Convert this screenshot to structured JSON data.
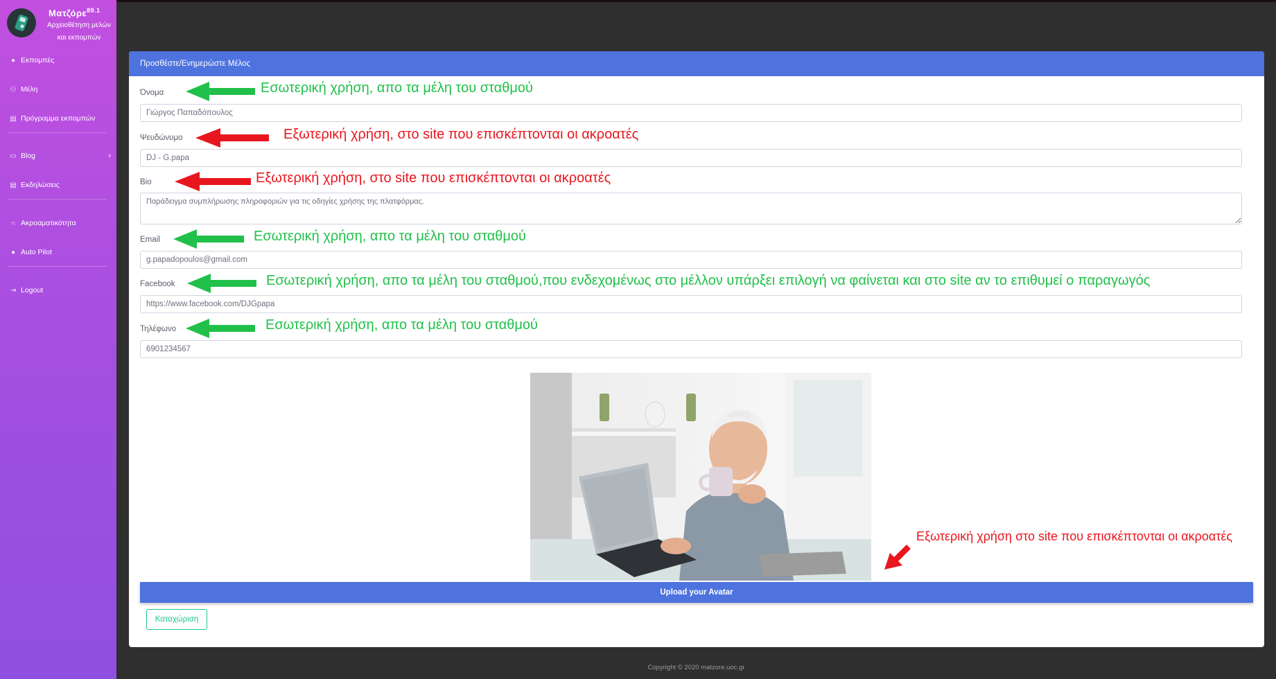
{
  "brand": {
    "title": "Ματζόρε",
    "freq": "89.1",
    "subtitle_line1": "Αρχειοθέτηση μελών",
    "subtitle_line2": "και εκπομπών"
  },
  "sidebar": {
    "items": [
      {
        "label": "Εκπομπές",
        "icon": "location-pin-icon"
      },
      {
        "label": "Μέλη",
        "icon": "users-icon"
      },
      {
        "label": "Πρόγραμμα εκπομπών",
        "icon": "calendar-icon"
      },
      {
        "label": "Blog",
        "icon": "newspaper-icon"
      },
      {
        "label": "Εκδηλώσεις",
        "icon": "calendar-icon"
      },
      {
        "label": "Ακροαματικότητα",
        "icon": "headphones-icon"
      },
      {
        "label": "Auto Pilot",
        "icon": "circle-icon"
      },
      {
        "label": "Logout",
        "icon": "sign-out-icon"
      }
    ]
  },
  "card": {
    "header": "Προσθέστε/Ενημερώστε Μέλος"
  },
  "form": {
    "name": {
      "label": "Όνομα",
      "value": "Γιώργος Παπαδόπουλος"
    },
    "nickname": {
      "label": "Ψευδώνυμο",
      "value": "DJ - G.papa"
    },
    "bio": {
      "label": "Bio",
      "value": "Παράδειγμα συμπλήρωσης πληροφοριών για τις οδηγίες χρήσης της πλατφόρμας."
    },
    "email": {
      "label": "Email",
      "value": "g.papadopoulos@gmail.com"
    },
    "facebook": {
      "label": "Facebook",
      "value": "https://www.facebook.com/DJGpapa"
    },
    "phone": {
      "label": "Τηλέφωνο",
      "value": "6901234567"
    }
  },
  "annotations": {
    "name": "Εσωτερική χρήση, απο τα μέλη του σταθμού",
    "nickname": "Εξωτερική χρήση, στο site που επισκέπτονται οι ακροατές",
    "bio": "Εξωτερική χρήση, στο site που επισκέπτονται οι ακροατές",
    "email": "Εσωτερική χρήση, απο τα μέλη του σταθμού",
    "facebook": "Εσωτερική χρήση, απο τα μέλη του σταθμού,που ενδεχομένως στο μέλλον υπάρξει επιλογή να φαίνεται και στο site αν το επιθυμεί ο παραγωγός",
    "phone": "Εσωτερική χρήση, απο τα μέλη του σταθμού",
    "avatar": "Εξωτερική χρήση στο site που επισκέπτονται οι ακροατές"
  },
  "buttons": {
    "upload": "Upload your Avatar",
    "submit": "Καταχώριση"
  },
  "footer": "Copyright © 2020 matzore.uoc.gr",
  "colors": {
    "primary": "#4e73df",
    "success": "#1cc88a",
    "internal": "#21c04a",
    "external": "#e8161e"
  }
}
